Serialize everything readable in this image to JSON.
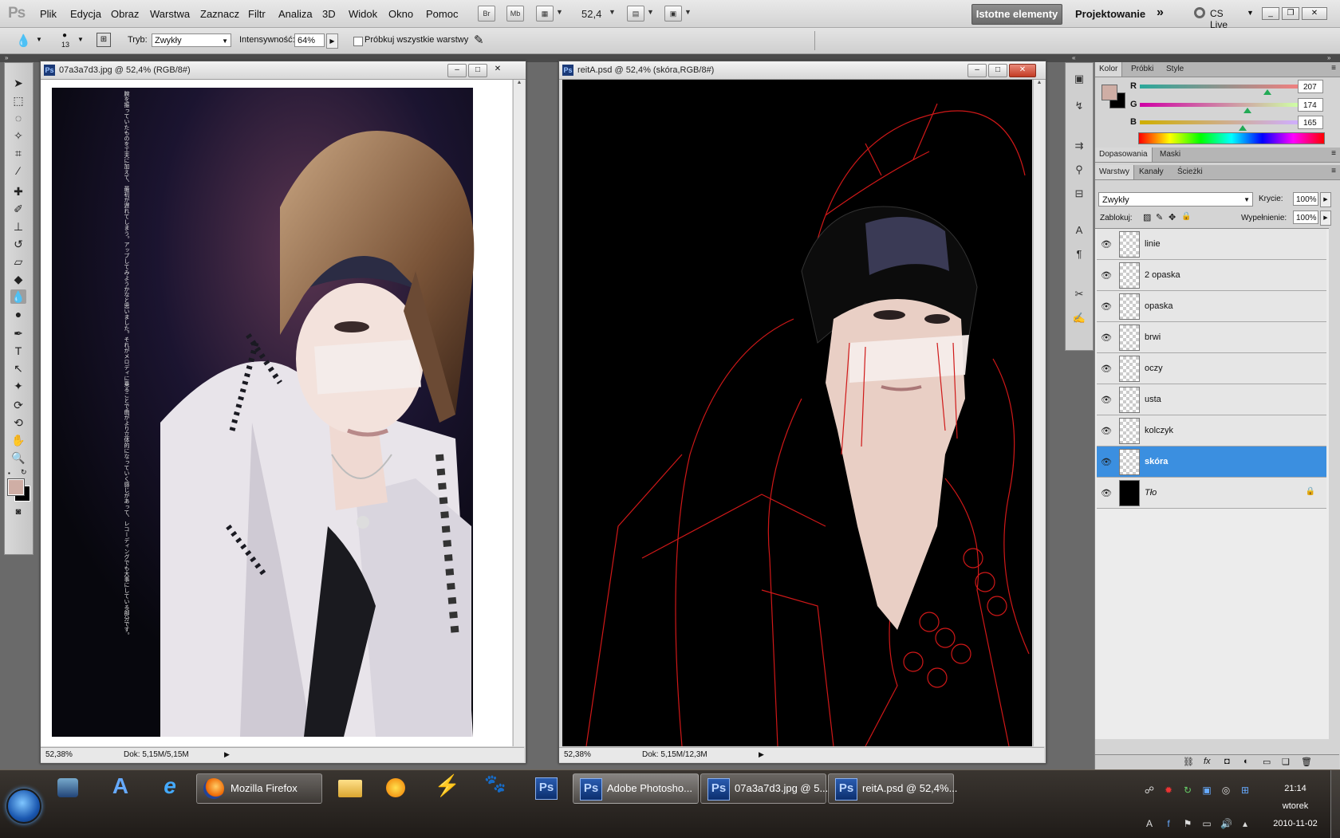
{
  "app": {
    "logo": "Ps"
  },
  "menu": [
    "Plik",
    "Edycja",
    "Obraz",
    "Warstwa",
    "Zaznacz",
    "Filtr",
    "Analiza",
    "3D",
    "Widok",
    "Okno",
    "Pomoc"
  ],
  "appbar": {
    "br": "Br",
    "mb": "Mb",
    "zoom": "52,4",
    "ws_active": "Istotne elementy",
    "ws_other": "Projektowanie",
    "ws_more": "»",
    "cslive": "CS Live"
  },
  "options": {
    "brush_size": "13",
    "mode_label": "Tryb:",
    "mode_value": "Zwykły",
    "intensity_label": "Intensywność:",
    "intensity_value": "64%",
    "sample_all": "Próbkuj wszystkie warstwy"
  },
  "doc1": {
    "title": "07a3a7d3.jpg @ 52,4% (RGB/8#)",
    "zoom": "52,38%",
    "dok": "Dok: 5,15M/5,15M"
  },
  "doc2": {
    "title": "reitA.psd @ 52,4% (skóra,RGB/8#)",
    "zoom": "52,38%",
    "dok": "Dok: 5,15M/12,3M"
  },
  "color_panel": {
    "tabs": [
      "Kolor",
      "Próbki",
      "Style"
    ],
    "r_label": "R",
    "g_label": "G",
    "b_label": "B",
    "r": "207",
    "g": "174",
    "b": "165",
    "r_frac": 0.81,
    "g_frac": 0.68,
    "b_frac": 0.65,
    "fg_color": "#cfaea5"
  },
  "adjust_tabs": [
    "Dopasowania",
    "Maski"
  ],
  "layers_panel": {
    "tabs": [
      "Warstwy",
      "Kanały",
      "Ścieżki"
    ],
    "blend": "Zwykły",
    "opacity_label": "Krycie:",
    "opacity": "100%",
    "lock_label": "Zablokuj:",
    "fill_label": "Wypełnienie:",
    "fill": "100%",
    "layers": [
      "linie",
      "2 opaska",
      "opaska",
      "brwi",
      "oczy",
      "usta",
      "kolczyk",
      "skóra",
      "Tło"
    ],
    "selected": "skóra"
  },
  "taskbar": {
    "firefox": "Mozilla Firefox",
    "ps_task": "Adobe Photosho...",
    "doc1_task": "07a3a7d3.jpg @ 5...",
    "doc2_task": "reitA.psd @ 52,4%...",
    "time": "21:14",
    "day": "wtorek",
    "date": "2010-11-02",
    "ps": "Ps"
  },
  "magazine_text": "腕を振っていたものを工夫に加えて、最初が遅れてしまう。アップしてみようかなと思いました。それがメロディに乗ることで曲がより立体的になっていく感じがあって、レコーディングでも大事にしている部分です。"
}
